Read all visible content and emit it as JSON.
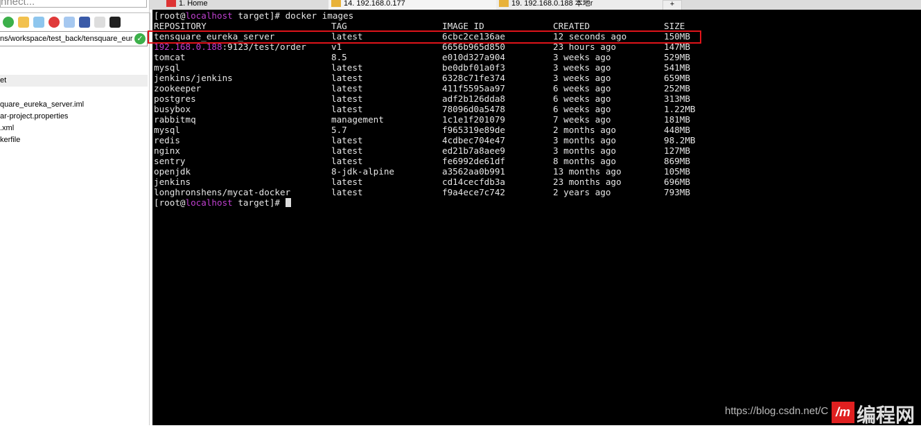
{
  "left_panel": {
    "connect_placeholder": "nnect...",
    "path": "ns/workspace/test_back/tensquare_eur",
    "selected": "et",
    "files": [
      "quare_eureka_server.iml",
      "ar-project.properties",
      ".xml",
      "kerfile"
    ]
  },
  "tabs": [
    {
      "label": "1. Home"
    },
    {
      "label": "14. 192.168.0.177",
      "close": "×"
    },
    {
      "label": "19. 192.168.0.188 本地r"
    }
  ],
  "terminal": {
    "prompt_user": "[root@",
    "prompt_host": "localhost",
    "prompt_rest": " target]# ",
    "command": "docker images",
    "headers": [
      "REPOSITORY",
      "TAG",
      "IMAGE ID",
      "CREATED",
      "SIZE"
    ],
    "rows": [
      [
        "tensquare_eureka_server",
        "latest",
        "6cbc2ce136ae",
        "12 seconds ago",
        "150MB"
      ],
      [
        "192.168.0.188:9123/test/order",
        "v1",
        "6656b965d850",
        "23 hours ago",
        "147MB"
      ],
      [
        "tomcat",
        "8.5",
        "e010d327a904",
        "3 weeks ago",
        "529MB"
      ],
      [
        "mysql",
        "latest",
        "be0dbf01a0f3",
        "3 weeks ago",
        "541MB"
      ],
      [
        "jenkins/jenkins",
        "latest",
        "6328c71fe374",
        "3 weeks ago",
        "659MB"
      ],
      [
        "zookeeper",
        "latest",
        "411f5595aa97",
        "6 weeks ago",
        "252MB"
      ],
      [
        "postgres",
        "latest",
        "adf2b126dda8",
        "6 weeks ago",
        "313MB"
      ],
      [
        "busybox",
        "latest",
        "78096d0a5478",
        "6 weeks ago",
        "1.22MB"
      ],
      [
        "rabbitmq",
        "management",
        "1c1e1f201079",
        "7 weeks ago",
        "181MB"
      ],
      [
        "mysql",
        "5.7",
        "f965319e89de",
        "2 months ago",
        "448MB"
      ],
      [
        "redis",
        "latest",
        "4cdbec704e47",
        "3 months ago",
        "98.2MB"
      ],
      [
        "nginx",
        "latest",
        "ed21b7a8aee9",
        "3 months ago",
        "127MB"
      ],
      [
        "sentry",
        "latest",
        "fe6992de61df",
        "8 months ago",
        "869MB"
      ],
      [
        "openjdk",
        "8-jdk-alpine",
        "a3562aa0b991",
        "13 months ago",
        "105MB"
      ],
      [
        "jenkins",
        "latest",
        "cd14cecfdb3a",
        "23 months ago",
        "696MB"
      ],
      [
        "longhronshens/mycat-docker",
        "latest",
        "f9a4ece7c742",
        "2 years ago",
        "793MB"
      ]
    ],
    "highlight_color": "#e0141a"
  },
  "watermark": {
    "url": "https://blog.csdn.net/C",
    "logo": "编程网"
  }
}
